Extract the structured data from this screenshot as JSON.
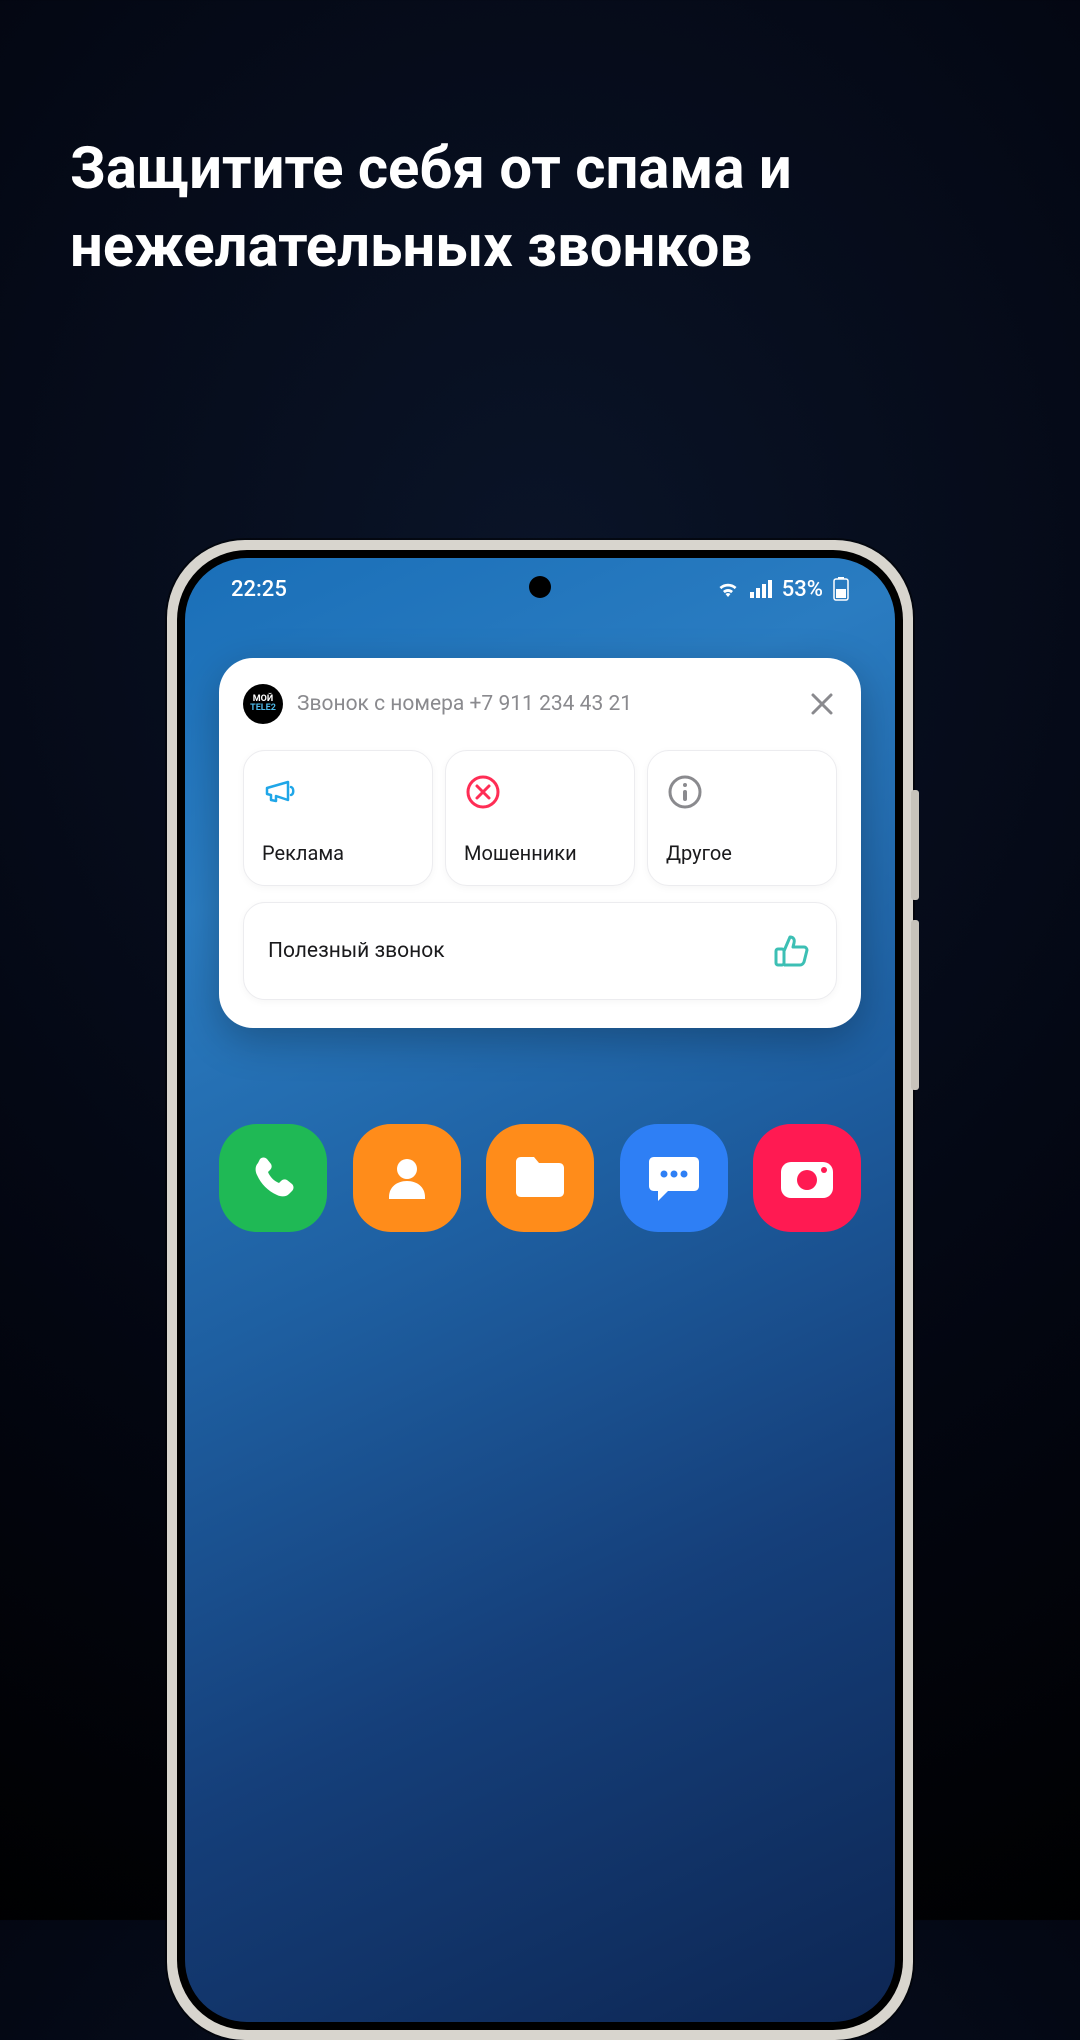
{
  "headline": "Защитите себя от спама и нежелательных звонков",
  "status": {
    "time": "22:25",
    "battery": "53%"
  },
  "notification": {
    "app_logo_line1": "МОЙ",
    "app_logo_line2": "TELE2",
    "title": "Звонок с номера +7 911 234 43 21",
    "categories": [
      {
        "label": "Реклама"
      },
      {
        "label": "Мошенники"
      },
      {
        "label": "Другое"
      }
    ],
    "useful_label": "Полезный звонок"
  },
  "dock": {
    "apps": [
      "phone",
      "contacts",
      "files",
      "messages",
      "camera"
    ]
  }
}
